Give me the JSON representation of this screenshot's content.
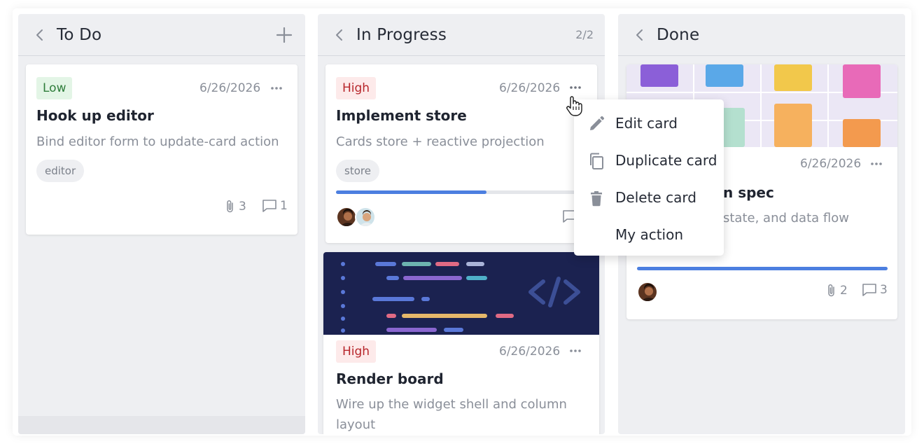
{
  "columns": [
    {
      "title": "To Do",
      "cards": [
        {
          "priority": "Low",
          "date": "6/26/2026",
          "title": "Hook up editor",
          "description": "Bind editor form to update-card action",
          "tag": "editor",
          "attachments": "3",
          "comments": "1"
        }
      ]
    },
    {
      "title": "In Progress",
      "count": "2/2",
      "cards": [
        {
          "priority": "High",
          "date": "6/26/2026",
          "title": "Implement store",
          "description": "Cards store + reactive projection",
          "tag": "store",
          "progress": 0.6
        },
        {
          "priority": "High",
          "date": "6/26/2026",
          "title": "Render board",
          "description": "Wire up the widget shell and column layout"
        }
      ]
    },
    {
      "title": "Done",
      "cards": [
        {
          "date": "6/26/2026",
          "title_partial": "n spec",
          "description_partial": "state, and data flow",
          "progress": 1.0,
          "attachments": "2",
          "comments": "3"
        }
      ]
    }
  ],
  "context_menu": {
    "items": [
      {
        "label": "Edit card",
        "icon": "pencil-icon"
      },
      {
        "label": "Duplicate card",
        "icon": "duplicate-icon"
      },
      {
        "label": "Delete card",
        "icon": "trash-icon"
      },
      {
        "label": "My action",
        "icon": ""
      }
    ]
  },
  "colors": {
    "accent": "#4c7fe0",
    "low_badge_bg": "#e3f5e6",
    "low_badge_text": "#2f7d3b",
    "high_badge_bg": "#fdeaea",
    "high_badge_text": "#b7262b",
    "column_bg": "#eeeff2"
  }
}
